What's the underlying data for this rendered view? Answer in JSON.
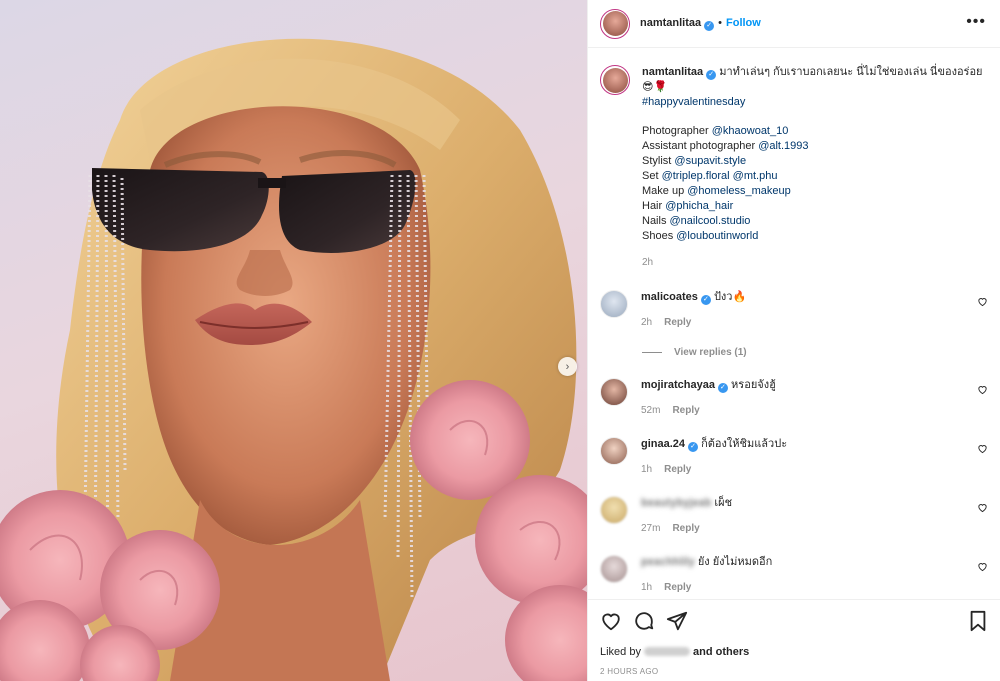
{
  "header": {
    "username": "namtanlitaa",
    "separator": "•",
    "follow_label": "Follow",
    "more_label": "•••"
  },
  "caption": {
    "username": "namtanlitaa",
    "text": "มาทำเล่นๆ กับเราบอกเลยนะ นี่ไม่ใช่ของเล่น นี่ของอร่อย 😎🌹",
    "hashtag": "#happyvalentinesday",
    "credits": [
      {
        "role": "Photographer",
        "tag": "@khaowoat_10"
      },
      {
        "role": "Assistant photographer",
        "tag": "@alt.1993"
      },
      {
        "role": "Stylist",
        "tag": "@supavit.style"
      },
      {
        "role": "Set",
        "tag": "@triplep.floral @mt.phu"
      },
      {
        "role": "Make up",
        "tag": "@homeless_makeup"
      },
      {
        "role": "Hair",
        "tag": "@phicha_hair"
      },
      {
        "role": "Nails",
        "tag": "@nailcool.studio"
      },
      {
        "role": "Shoes",
        "tag": "@louboutinworld"
      }
    ],
    "time": "2h"
  },
  "comments": [
    {
      "username": "malicoates",
      "verified": true,
      "text": "ปังว🔥",
      "time": "2h",
      "reply_label": "Reply",
      "view_replies": "View replies (1)"
    },
    {
      "username": "mojiratchayaa",
      "verified": true,
      "text": "หรอยจังฮู้",
      "time": "52m",
      "reply_label": "Reply"
    },
    {
      "username": "ginaa.24",
      "verified": true,
      "text": "ก็ต้องให้ชิมแล้วปะ",
      "time": "1h",
      "reply_label": "Reply"
    },
    {
      "username": "beautybyjeab",
      "verified": false,
      "text": "เผ็ช",
      "time": "27m",
      "reply_label": "Reply"
    },
    {
      "username": "peachhlily",
      "verified": false,
      "text": "ยัง ยังไม่หมดอีก",
      "time": "1h",
      "reply_label": "Reply"
    }
  ],
  "footer": {
    "liked_by_prefix": "Liked by",
    "liked_by_suffix": "and others",
    "posted_ago": "2 HOURS AGO"
  },
  "colors": {
    "accent": "#0095f6",
    "verified": "#3897f0",
    "tag": "#00376b",
    "muted": "#8e8e8e"
  },
  "icons": [
    "more-options-icon",
    "verified-badge-icon",
    "heart-icon",
    "comment-icon",
    "share-icon",
    "bookmark-icon",
    "chevron-right-icon"
  ]
}
